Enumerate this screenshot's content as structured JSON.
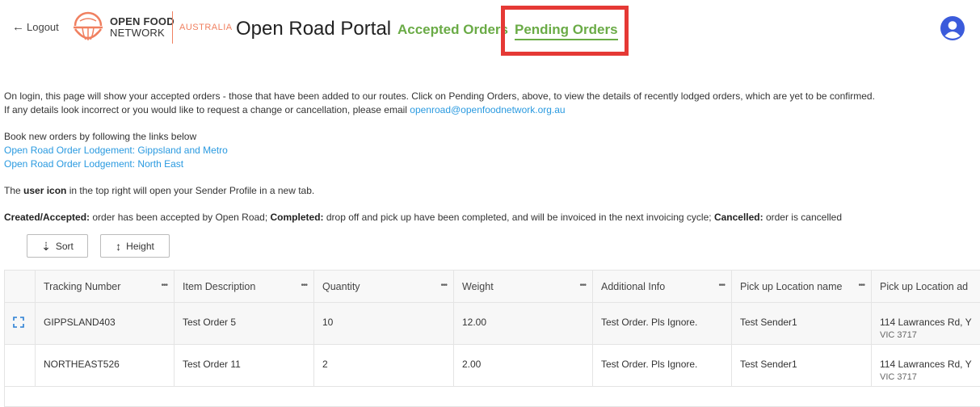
{
  "header": {
    "logout_label": "Logout",
    "logo_line1": "OPEN FOOD",
    "logo_line2": "NETWORK",
    "logo_region": "AUSTRALIA",
    "portal_title": "Open Road Portal",
    "nav": {
      "accepted": "Accepted Orders",
      "pending": "Pending Orders"
    }
  },
  "colors": {
    "brand_green": "#6aab46",
    "brand_orange": "#f08060",
    "link_blue": "#2a9ae0",
    "highlight_red": "#e53935",
    "user_icon": "#3b5bdb"
  },
  "info": {
    "p1_line1": "On login, this page will show your accepted orders - those that have been added to our routes. Click on Pending Orders, above, to view the details of recently lodged orders, which are yet to be confirmed.",
    "p1_line2_prefix": "If any details look incorrect or you would like to request a change or cancellation, please email ",
    "email": "openroad@openfoodnetwork.org.au",
    "book_intro": "Book new orders by following the links below",
    "link_gippsland": "Open Road Order Lodgement: Gippsland and Metro",
    "link_northeast": "Open Road Order Lodgement: North East",
    "user_icon_prefix": "The ",
    "user_icon_bold": "user icon",
    "user_icon_suffix": " in the top right will open your Sender Profile in a new tab.",
    "status_created_label": "Created/Accepted:",
    "status_created_text": " order has been accepted by Open Road; ",
    "status_completed_label": "Completed:",
    "status_completed_text": " drop off and pick up have been completed, and will be invoiced in the next invoicing cycle; ",
    "status_cancelled_label": "Cancelled:",
    "status_cancelled_text": " order is cancelled"
  },
  "toolbar": {
    "sort_label": "Sort",
    "height_label": "Height"
  },
  "table": {
    "columns": [
      "Tracking Number",
      "Item Description",
      "Quantity",
      "Weight",
      "Additional Info",
      "Pick up Location name",
      "Pick up Location ad"
    ],
    "rows": [
      {
        "tracking": "GIPPSLAND403",
        "description": "Test Order 5",
        "quantity": "10",
        "weight": "12.00",
        "info": "Test Order. Pls Ignore.",
        "location_name": "Test Sender1",
        "location_address": "114 Lawrances Rd, Y",
        "location_address_2": "VIC 3717"
      },
      {
        "tracking": "NORTHEAST526",
        "description": "Test Order 11",
        "quantity": "2",
        "weight": "2.00",
        "info": "Test Order. Pls Ignore.",
        "location_name": "Test Sender1",
        "location_address": "114 Lawrances Rd, Y",
        "location_address_2": "VIC 3717"
      }
    ]
  }
}
